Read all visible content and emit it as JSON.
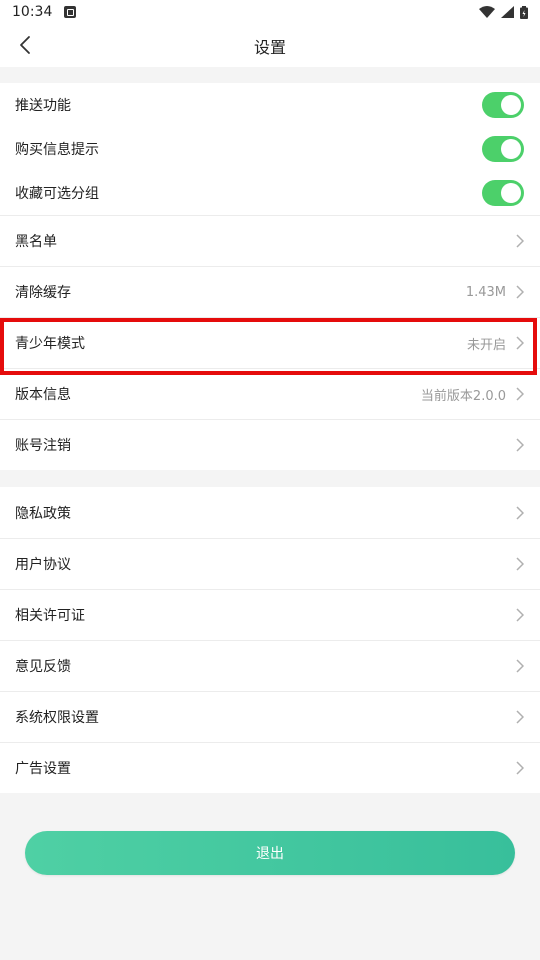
{
  "status_bar": {
    "time": "10:34"
  },
  "header": {
    "title": "设置"
  },
  "toggles": [
    {
      "label": "推送功能",
      "on": true
    },
    {
      "label": "购买信息提示",
      "on": true
    },
    {
      "label": "收藏可选分组",
      "on": true
    }
  ],
  "section1": [
    {
      "label": "黑名单",
      "value": ""
    },
    {
      "label": "清除缓存",
      "value": "1.43M"
    },
    {
      "label": "青少年模式",
      "value": "未开启"
    },
    {
      "label": "版本信息",
      "value": "当前版本2.0.0"
    },
    {
      "label": "账号注销",
      "value": ""
    }
  ],
  "section2": [
    {
      "label": "隐私政策"
    },
    {
      "label": "用户协议"
    },
    {
      "label": "相关许可证"
    },
    {
      "label": "意见反馈"
    },
    {
      "label": "系统权限设置"
    },
    {
      "label": "广告设置"
    }
  ],
  "logout_label": "退出",
  "colors": {
    "toggle_on": "#4cd06a",
    "highlight": "#e50c0c",
    "button_gradient_start": "#4fd0a4",
    "button_gradient_end": "#38bf9b"
  }
}
